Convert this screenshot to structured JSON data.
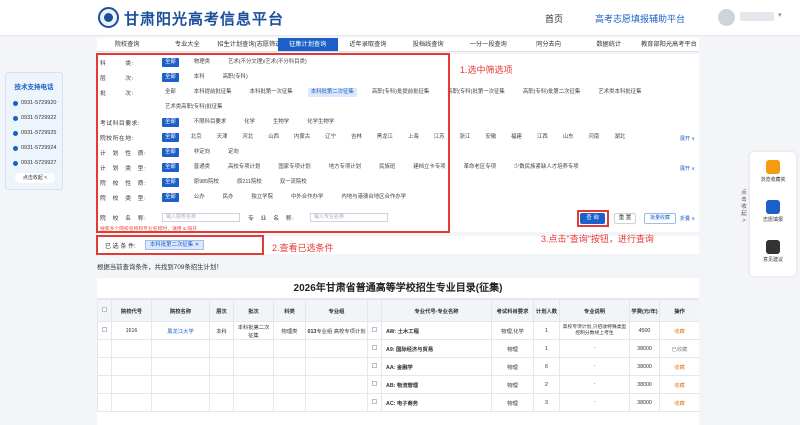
{
  "header": {
    "site_title": "甘肃阳光高考信息平台",
    "nav_home": "首页",
    "nav_assist": "高考志愿填报辅助平台"
  },
  "tabs": [
    {
      "label": "院校查询",
      "active": false
    },
    {
      "label": "专业大全",
      "active": false
    },
    {
      "label": "招生计划查询(志愿筛选)",
      "active": false
    },
    {
      "label": "征集计划查询",
      "active": true
    },
    {
      "label": "近年录取查询",
      "active": false
    },
    {
      "label": "投档线查询",
      "active": false
    },
    {
      "label": "一分一段查询",
      "active": false
    },
    {
      "label": "同分去向",
      "active": false
    },
    {
      "label": "数据统计",
      "active": false
    },
    {
      "label": "教育部阳光高考平台",
      "active": false
    }
  ],
  "support": {
    "title": "技术支持电话",
    "phones": [
      "0931-5729920",
      "0931-5729922",
      "0931-5729925",
      "0931-5729924",
      "0931-5729927"
    ],
    "collapse_label": "点击收起 <"
  },
  "filters": {
    "rows": [
      {
        "label": "科　　　类:",
        "options": [
          "全部",
          "物理类",
          "艺术(不分文理)/艺术(不分科目类)"
        ],
        "selected": 0
      },
      {
        "label": "层　　　次:",
        "options": [
          "全部",
          "本科",
          "高职(专科)"
        ],
        "selected": 0
      },
      {
        "label": "批　　　次:",
        "options": [
          "全部",
          "本科提前批征集",
          "本科批第一次征集",
          "本科批第二次征集",
          "高职(专科)批提前批征集",
          "高职(专科)批第一次征集",
          "高职(专科)批第二次征集",
          "艺术类本科批征集"
        ],
        "selected": 3
      },
      {
        "label": "",
        "options": [
          "艺术类高职(专科)批征集"
        ],
        "selected": -1
      },
      {
        "label": "考试科目要求:",
        "options": [
          "全部",
          "不限科目要求",
          "化学",
          "生物学",
          "化学生物学"
        ],
        "selected": 0
      },
      {
        "label": "院校所在地:",
        "options": [
          "全部",
          "北京",
          "天津",
          "河北",
          "山西",
          "内蒙古",
          "辽宁",
          "吉林",
          "黑龙江",
          "上海",
          "江苏",
          "浙江",
          "安徽",
          "福建",
          "江西",
          "山东",
          "河南",
          "湖北"
        ],
        "selected": 0,
        "expand": "展开 ∨"
      },
      {
        "label": "计　划　性　质:",
        "options": [
          "全部",
          "非定向",
          "定向"
        ],
        "selected": 0
      },
      {
        "label": "计　划　类　型:",
        "options": [
          "全部",
          "普通类",
          "高校专项计划",
          "国家专项计划",
          "地方专项计划",
          "民族班",
          "建档立卡专项",
          "革命老区专项",
          "少数民族紧缺人才培养专项"
        ],
        "selected": 0,
        "expand": "展开 ∨"
      },
      {
        "label": "院　校　性　质:",
        "options": [
          "全部",
          "原985院校",
          "原211院校",
          "双一流院校"
        ],
        "selected": 0
      },
      {
        "label": "院　校　类　型:",
        "options": [
          "全部",
          "公办",
          "民办",
          "独立学院",
          "中外合作办学",
          "内地与港澳台地区合作办学"
        ],
        "selected": 0
      }
    ],
    "school_name_label": "院　校　名　称:",
    "school_name_placeholder": "输入院校名称",
    "major_name_label": "专　业　名　称:",
    "major_name_placeholder": "输入专业名称",
    "hint": "搜索多个院校名称和专业名称时，请用 & 隔开",
    "query_label": "查 询",
    "reset_label": "重 置",
    "batch_label": "批量收藏",
    "collapse_label": "折叠 ∧"
  },
  "selected": {
    "label": "已 选 条 件:",
    "tag": "本科批第二次征集 ✕"
  },
  "result_count": "根据当前查询条件，共找到709条招生计划！",
  "annotations": {
    "a1": "1.选中筛选项",
    "a2": "2.查看已选条件",
    "a3": "3.点击\"查询\"按钮，进行查询"
  },
  "table": {
    "title": "2026年甘肃省普通高等学校招生专业目录(征集)",
    "headers": [
      "",
      "院校代号",
      "院校名称",
      "层次",
      "批次",
      "科类",
      "专业组",
      "",
      "专业代号-专业名称",
      "考试科目要求",
      "计划人数",
      "专业说明",
      "学费(元/年)",
      "操作"
    ],
    "rows": [
      {
        "code": "1616",
        "school": "黑龙江大学",
        "level": "本科",
        "batch": "本科批第二次征集",
        "kind": "物理类",
        "group_code": "013",
        "group_name": "专业组 高校专项计划",
        "major_code": "AW:",
        "major_name": "土木工程",
        "subject": "物理,化学",
        "plan": "1",
        "note": "高校专项计划,只招收特殊类型控制分数线上考生",
        "fee": "4500",
        "action": "收藏"
      },
      {
        "code": "",
        "school": "",
        "level": "",
        "batch": "",
        "kind": "",
        "group_code": "",
        "group_name": "",
        "major_code": "A9:",
        "major_name": "国际经济与贸易",
        "subject": "物理",
        "plan": "1",
        "note": "-",
        "fee": "38000",
        "action": "已收藏"
      },
      {
        "code": "",
        "school": "",
        "level": "",
        "batch": "",
        "kind": "",
        "group_code": "",
        "group_name": "",
        "major_code": "AA:",
        "major_name": "金融学",
        "subject": "物理",
        "plan": "6",
        "note": "-",
        "fee": "38000",
        "action": "收藏"
      },
      {
        "code": "",
        "school": "",
        "level": "",
        "batch": "",
        "kind": "",
        "group_code": "",
        "group_name": "",
        "major_code": "AB:",
        "major_name": "物流管理",
        "subject": "物理",
        "plan": "2",
        "note": "-",
        "fee": "38000",
        "action": "收藏"
      },
      {
        "code": "",
        "school": "",
        "level": "",
        "batch": "",
        "kind": "",
        "group_code": "",
        "group_name": "",
        "major_code": "AC:",
        "major_name": "电子商务",
        "subject": "物理",
        "plan": "3",
        "note": "-",
        "fee": "38000",
        "action": "收藏"
      }
    ]
  },
  "right_sidebar": {
    "vertical_label": "点击收起 >",
    "items": [
      {
        "label": "浏览收藏夹",
        "icon": "bookmark-icon",
        "color": "#f39c12"
      },
      {
        "label": "志愿填报",
        "icon": "document-icon",
        "color": "#1b5fc8"
      },
      {
        "label": "意见建议",
        "icon": "qrcode-icon",
        "color": "#333333"
      }
    ]
  },
  "colors": {
    "primary": "#1b5fc8",
    "annotation": "#e53935",
    "action": "#e67e22"
  }
}
